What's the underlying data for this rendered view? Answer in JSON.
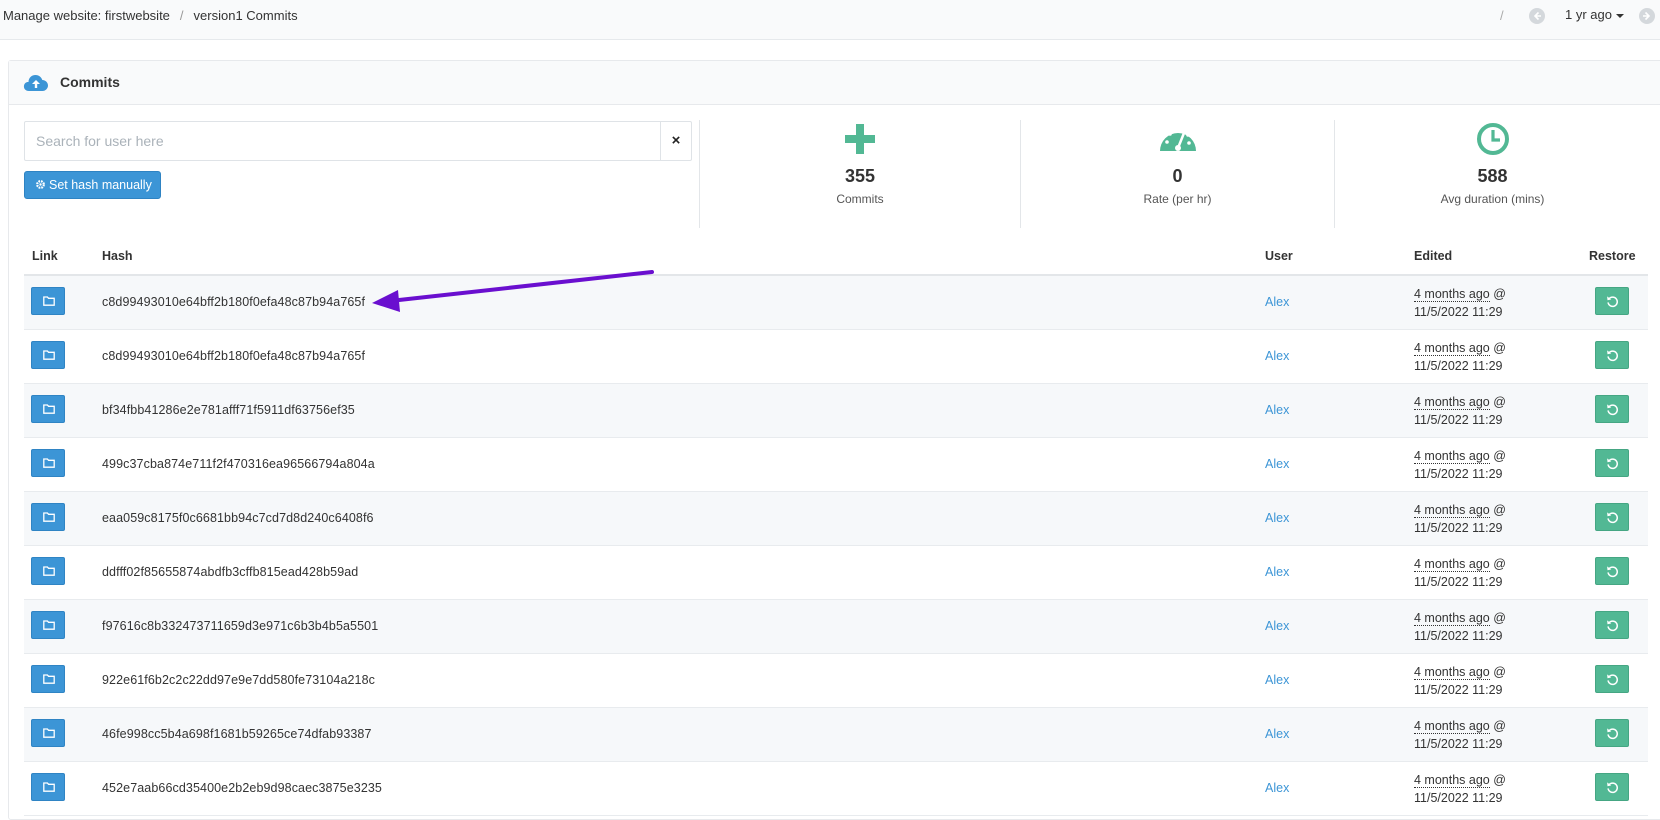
{
  "breadcrumb": {
    "site": "Manage website: firstwebsite",
    "sep": "/",
    "current": "version1 Commits"
  },
  "topbar": {
    "slash": "/",
    "time_filter": "1 yr ago"
  },
  "panel": {
    "title": "Commits"
  },
  "search": {
    "placeholder": "Search for user here",
    "value": "",
    "clear": "×"
  },
  "set_hash_button": "Set hash manually",
  "stats": [
    {
      "value": "355",
      "label": "Commits",
      "icon": "plus-icon"
    },
    {
      "value": "0",
      "label": "Rate (per hr)",
      "icon": "speedometer-icon"
    },
    {
      "value": "588",
      "label": "Avg duration (mins)",
      "icon": "clock-icon"
    }
  ],
  "table": {
    "headers": {
      "link": "Link",
      "hash": "Hash",
      "user": "User",
      "edited": "Edited",
      "restore": "Restore"
    },
    "rows": [
      {
        "hash": "c8d99493010e64bff2b180f0efa48c87b94a765f",
        "user": "Alex",
        "edited_rel": "4 months ago",
        "edited_abs": "11/5/2022 11:29"
      },
      {
        "hash": "c8d99493010e64bff2b180f0efa48c87b94a765f",
        "user": "Alex",
        "edited_rel": "4 months ago",
        "edited_abs": "11/5/2022 11:29"
      },
      {
        "hash": "bf34fbb41286e2e781afff71f5911df63756ef35",
        "user": "Alex",
        "edited_rel": "4 months ago",
        "edited_abs": "11/5/2022 11:29"
      },
      {
        "hash": "499c37cba874e711f2f470316ea96566794a804a",
        "user": "Alex",
        "edited_rel": "4 months ago",
        "edited_abs": "11/5/2022 11:29"
      },
      {
        "hash": "eaa059c8175f0c6681bb94c7cd7d8d240c6408f6",
        "user": "Alex",
        "edited_rel": "4 months ago",
        "edited_abs": "11/5/2022 11:29"
      },
      {
        "hash": "ddfff02f85655874abdfb3cffb815ead428b59ad",
        "user": "Alex",
        "edited_rel": "4 months ago",
        "edited_abs": "11/5/2022 11:29"
      },
      {
        "hash": "f97616c8b332473711659d3e971c6b3b4b5a5501",
        "user": "Alex",
        "edited_rel": "4 months ago",
        "edited_abs": "11/5/2022 11:29"
      },
      {
        "hash": "922e61f6b2c2c22dd97e9e7dd580fe73104a218c",
        "user": "Alex",
        "edited_rel": "4 months ago",
        "edited_abs": "11/5/2022 11:29"
      },
      {
        "hash": "46fe998cc5b4a698f1681b59265ce74dfab93387",
        "user": "Alex",
        "edited_rel": "4 months ago",
        "edited_abs": "11/5/2022 11:29"
      },
      {
        "hash": "452e7aab66cd35400e2b2eb9d98caec3875e3235",
        "user": "Alex",
        "edited_rel": "4 months ago",
        "edited_abs": "11/5/2022 11:29"
      }
    ]
  },
  "colors": {
    "primary": "#3c95d6",
    "success": "#52b894",
    "annotation_arrow": "#6a0fcf"
  }
}
